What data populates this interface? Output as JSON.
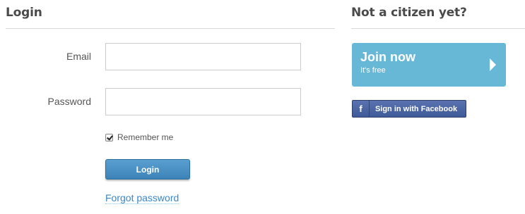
{
  "login": {
    "heading": "Login",
    "email_label": "Email",
    "email_value": "",
    "password_label": "Password",
    "password_value": "",
    "remember_label": "Remember me",
    "remember_checked": true,
    "submit_label": "Login",
    "forgot_label": "Forgot password"
  },
  "signup": {
    "heading": "Not a citizen yet?",
    "join_title": "Join now",
    "join_subtitle": "It's free",
    "facebook_label": "Sign in with Facebook",
    "facebook_icon_glyph": "f"
  },
  "colors": {
    "join_bg": "#67b7d6",
    "login_button": "#4a90c6",
    "facebook_button": "#4a64a3",
    "link": "#3a87c8"
  },
  "icons": {
    "checkbox": "checkmark-icon",
    "join_arrow": "arrow-right-icon",
    "facebook": "facebook-icon"
  }
}
